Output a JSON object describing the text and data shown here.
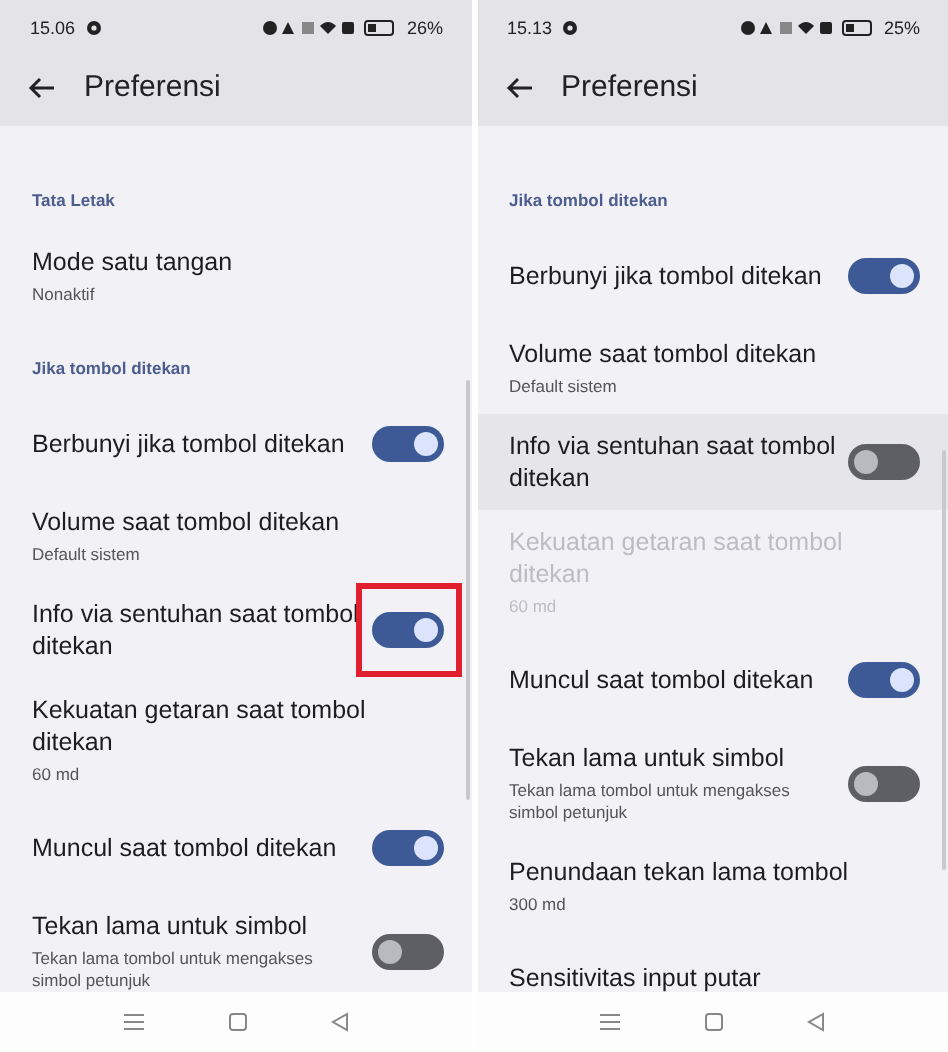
{
  "screens": [
    {
      "status_bar": {
        "time": "15.06",
        "battery": "26%"
      },
      "title": "Preferensi",
      "items": [
        {
          "kind": "header",
          "title": "Tata Letak"
        },
        {
          "kind": "setting",
          "title": "Mode satu tangan",
          "subtitle": "Nonaktif"
        },
        {
          "kind": "header",
          "title": "Jika tombol ditekan"
        },
        {
          "kind": "toggle",
          "title": "Berbunyi jika tombol ditekan",
          "on": true
        },
        {
          "kind": "setting",
          "title": "Volume saat tombol ditekan",
          "subtitle": "Default sistem"
        },
        {
          "kind": "toggle",
          "title": "Info via sentuhan saat tombol ditekan",
          "on": true,
          "highlighted": true
        },
        {
          "kind": "setting",
          "title": "Kekuatan getaran saat tombol ditekan",
          "subtitle": "60 md"
        },
        {
          "kind": "toggle",
          "title": "Muncul saat tombol ditekan",
          "on": true
        },
        {
          "kind": "toggle",
          "title": "Tekan lama untuk simbol",
          "subtitle": "Tekan lama tombol untuk mengakses simbol petunjuk",
          "on": false
        }
      ]
    },
    {
      "status_bar": {
        "time": "15.13",
        "battery": "25%"
      },
      "title": "Preferensi",
      "items": [
        {
          "kind": "header",
          "title": "Jika tombol ditekan"
        },
        {
          "kind": "toggle",
          "title": "Berbunyi jika tombol ditekan",
          "on": true
        },
        {
          "kind": "setting",
          "title": "Volume saat tombol ditekan",
          "subtitle": "Default sistem"
        },
        {
          "kind": "toggle",
          "title": "Info via sentuhan saat tombol ditekan",
          "on": false,
          "pressed": true
        },
        {
          "kind": "setting",
          "title": "Kekuatan getaran saat tombol ditekan",
          "subtitle": "60 md",
          "disabled": true
        },
        {
          "kind": "toggle",
          "title": "Muncul saat tombol ditekan",
          "on": true
        },
        {
          "kind": "toggle",
          "title": "Tekan lama untuk simbol",
          "subtitle": "Tekan lama tombol untuk mengakses simbol petunjuk",
          "on": false
        },
        {
          "kind": "setting",
          "title": "Penundaan tekan lama tombol",
          "subtitle": "300 md"
        },
        {
          "kind": "setting",
          "title": "Sensitivitas input putar"
        }
      ]
    }
  ]
}
